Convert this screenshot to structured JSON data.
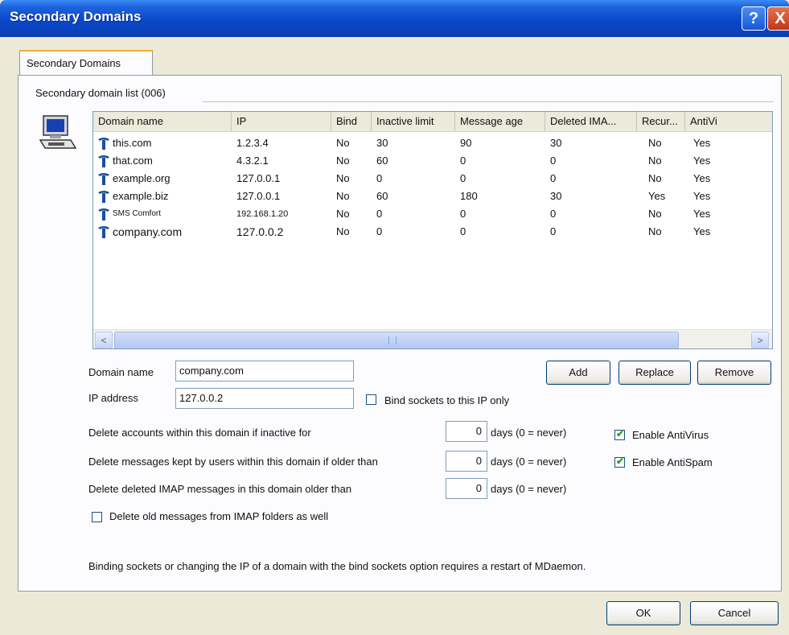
{
  "window": {
    "title": "Secondary Domains",
    "help_glyph": "?",
    "close_glyph": "X"
  },
  "tab": {
    "label": "Secondary Domains"
  },
  "group": {
    "label": "Secondary domain list (006)"
  },
  "table": {
    "columns": [
      "Domain name",
      "IP",
      "Bind",
      "Inactive limit",
      "Message age",
      "Deleted IMA...",
      "Recur...",
      "AntiVi"
    ],
    "rows": [
      [
        "this.com",
        "1.2.3.4",
        "No",
        "30",
        "90",
        "30",
        "No",
        "Yes"
      ],
      [
        "that.com",
        "4.3.2.1",
        "No",
        "60",
        "0",
        "0",
        "No",
        "Yes"
      ],
      [
        "example.org",
        "127.0.0.1",
        "No",
        "0",
        "0",
        "0",
        "No",
        "Yes"
      ],
      [
        "example.biz",
        "127.0.0.1",
        "No",
        "60",
        "180",
        "30",
        "Yes",
        "Yes"
      ],
      [
        "SMS Comfort",
        "192.168.1.20",
        "No",
        "0",
        "0",
        "0",
        "No",
        "Yes"
      ],
      [
        "company.com",
        "127.0.0.2",
        "No",
        "0",
        "0",
        "0",
        "No",
        "Yes"
      ]
    ],
    "row_icon": "domain-icon"
  },
  "form": {
    "domain_label": "Domain name",
    "domain_value": "company.com",
    "ip_label": "IP address",
    "ip_value": "127.0.0.2",
    "bind_label": "Bind sockets to this IP only",
    "bind_checked": false,
    "inactive_label": "Delete accounts within this domain if inactive for",
    "inactive_value": "0",
    "msg_label": "Delete messages kept by users within this domain if older than",
    "msg_value": "0",
    "imap_label": "Delete deleted IMAP messages in this domain older than",
    "imap_value": "0",
    "days_label": "days (0 = never)",
    "antivirus_label": "Enable AntiVirus",
    "antivirus_checked": true,
    "antispam_label": "Enable AntiSpam",
    "antispam_checked": true,
    "old_imap_label": "Delete old messages from IMAP folders as well",
    "old_imap_checked": false,
    "note": "Binding sockets or changing the IP of a domain with the bind sockets option requires a restart of MDaemon."
  },
  "buttons": {
    "add": "Add",
    "replace": "Replace",
    "remove": "Remove",
    "ok": "OK",
    "cancel": "Cancel"
  },
  "scroll": {
    "left_glyph": "<",
    "right_glyph": ">",
    "grip_glyph": "III"
  },
  "colors": {
    "title_bar": "#0a48c8",
    "accent_tab": "#f5b033",
    "check_mark": "#21a121"
  }
}
